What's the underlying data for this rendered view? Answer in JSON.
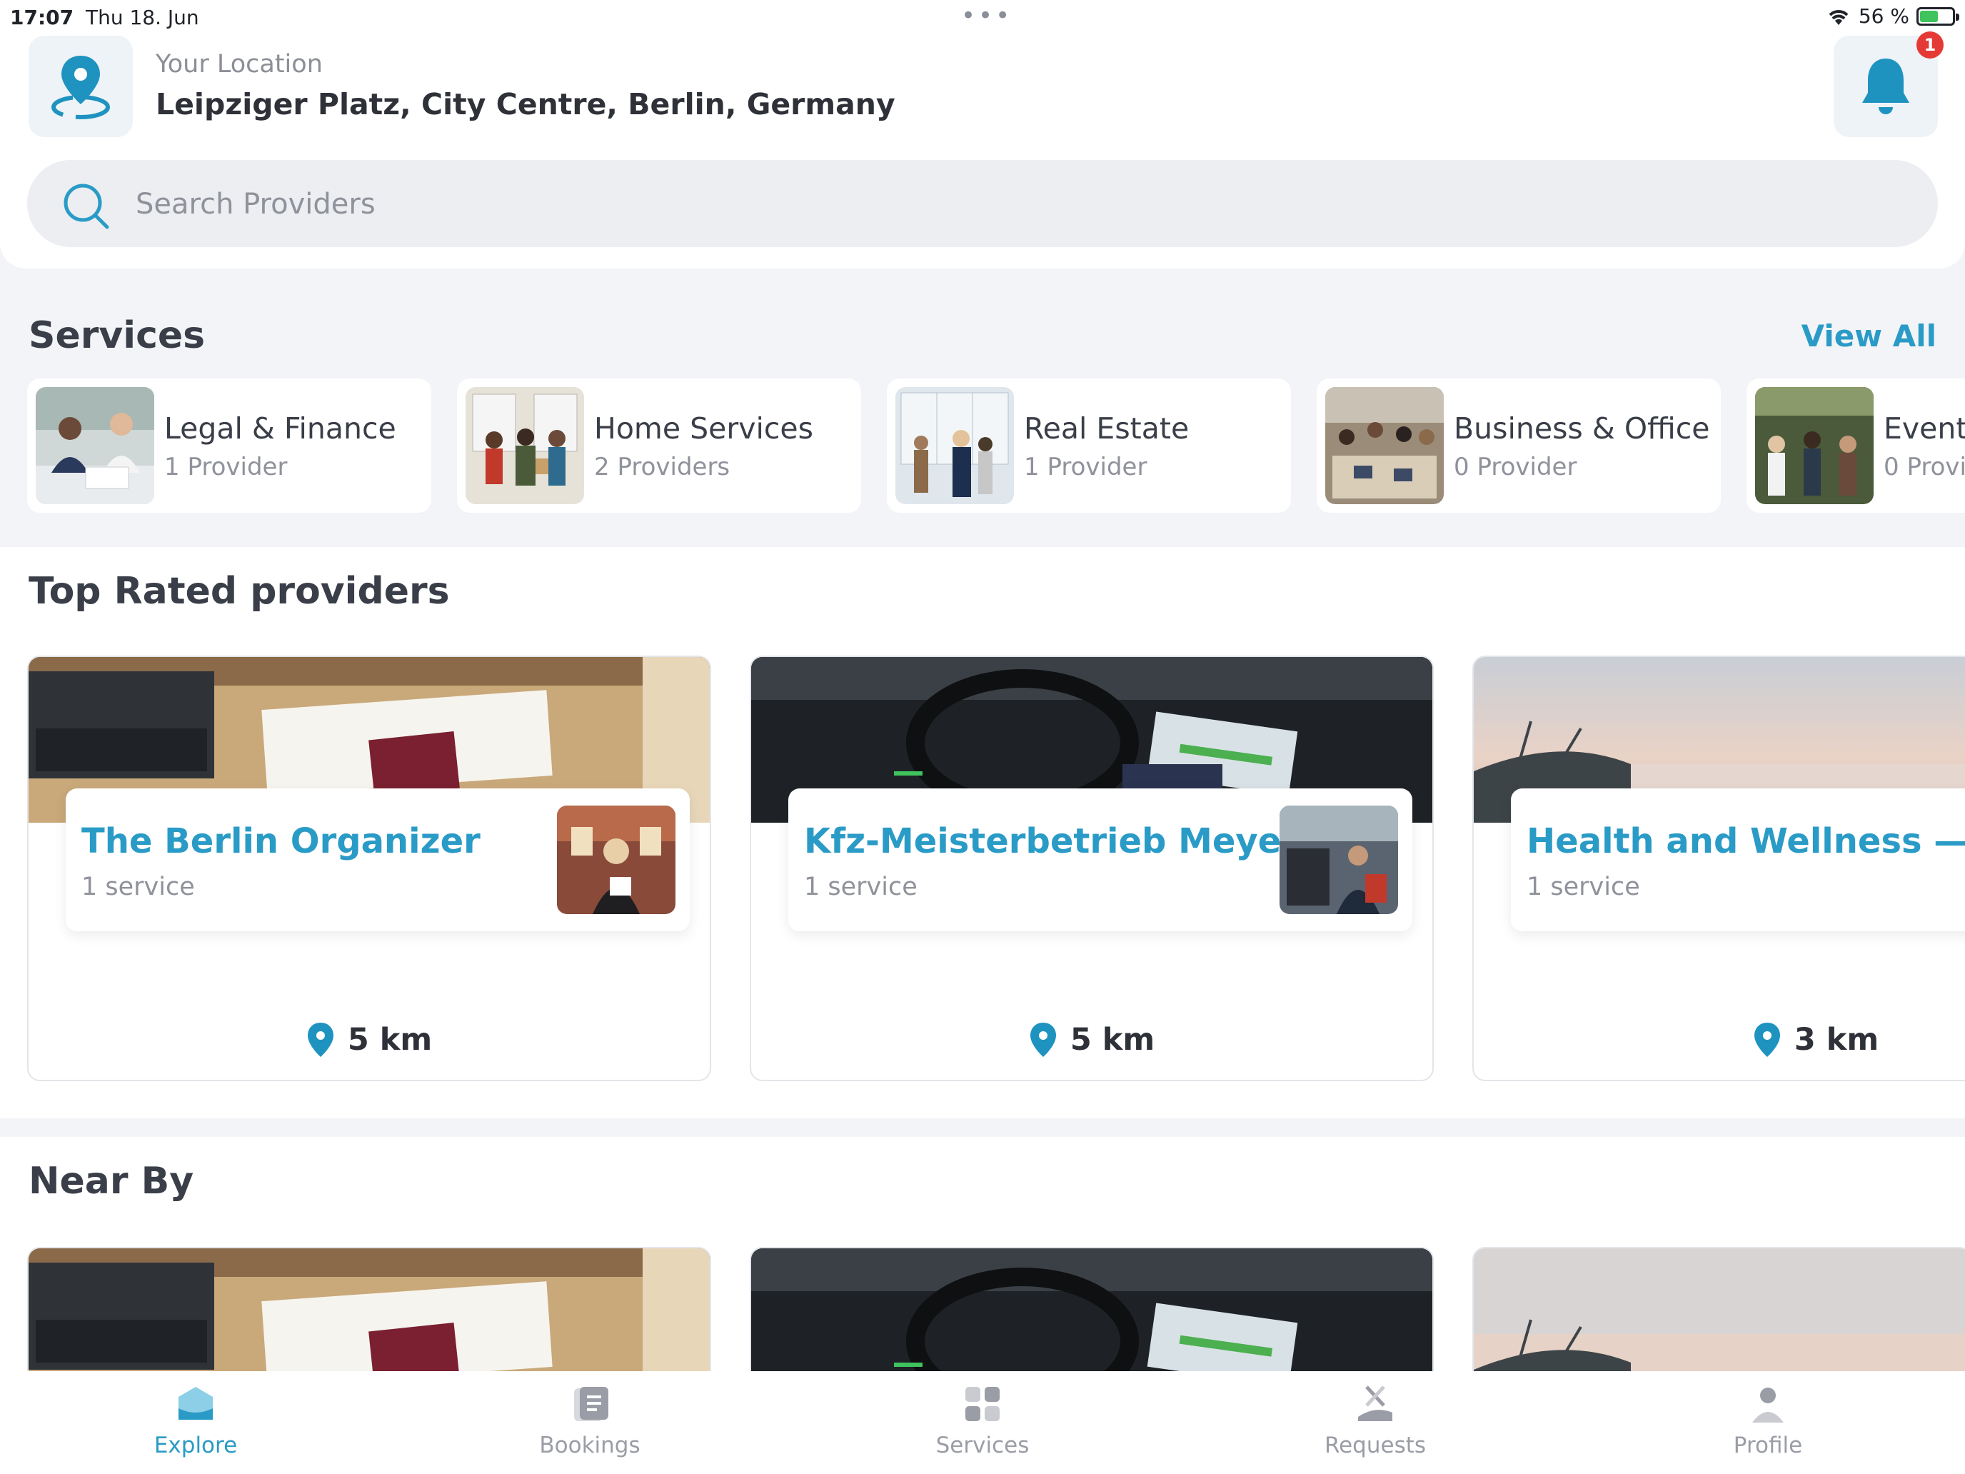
{
  "status_bar": {
    "time": "17:07",
    "date": "Thu 18. Jun",
    "battery": "56 %",
    "battery_fraction": 0.56
  },
  "header": {
    "location_caption": "Your Location",
    "location_value": "Leipziger Platz, City Centre, Berlin, Germany",
    "notification_count": "1",
    "search_placeholder": "Search Providers"
  },
  "services": {
    "title": "Services",
    "view_all": "View All",
    "items": [
      {
        "name": "Legal & Finance",
        "count": "1 Provider"
      },
      {
        "name": "Home Services",
        "count": "2 Providers"
      },
      {
        "name": "Real Estate",
        "count": "1 Provider"
      },
      {
        "name": "Business & Office",
        "count": "0 Provider"
      },
      {
        "name": "Event",
        "count": "0 Provi"
      }
    ]
  },
  "top_rated": {
    "title": "Top Rated providers",
    "items": [
      {
        "name": "The Berlin Organizer",
        "services": "1 service",
        "distance": "5 km"
      },
      {
        "name": "Kfz-Meisterbetrieb Meyer",
        "services": "1 service",
        "distance": "5 km"
      },
      {
        "name": "Health and Wellness — Mi",
        "services": "1 service",
        "distance": "3 km"
      }
    ]
  },
  "near_by": {
    "title": "Near By"
  },
  "bottom_nav": {
    "active": "Explore",
    "items": [
      "Explore",
      "Bookings",
      "Services",
      "Requests",
      "Profile"
    ]
  },
  "colors": {
    "accent": "#2a9bc6",
    "badge": "#e53935",
    "background": "#f3f4f7"
  }
}
